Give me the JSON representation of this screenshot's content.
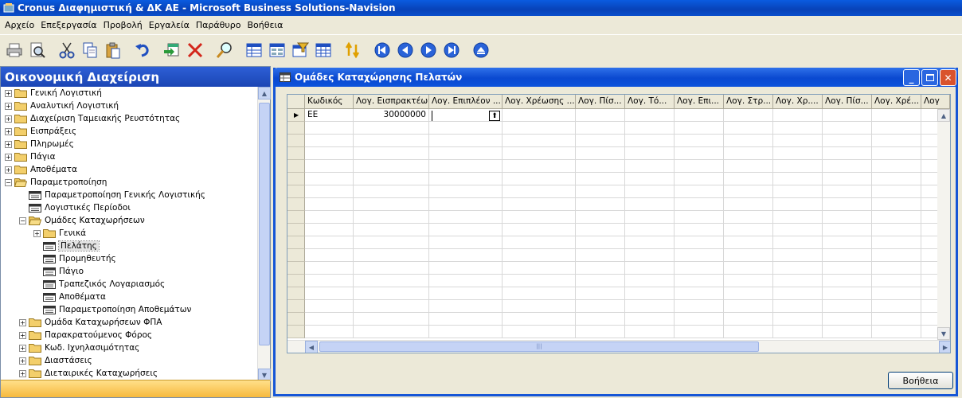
{
  "app": {
    "title": "Cronus Διαφημιστική & ΔΚ ΑΕ - Microsoft Business Solutions-Navision"
  },
  "menu": [
    "Αρχείο",
    "Επεξεργασία",
    "Προβολή",
    "Εργαλεία",
    "Παράθυρο",
    "Βοήθεια"
  ],
  "toolbar": {
    "icons": [
      "print-icon",
      "print-preview-icon",
      "cut-icon",
      "copy-icon",
      "paste-icon",
      "undo-icon",
      "insert-icon",
      "delete-icon",
      "find-icon",
      "list-icon",
      "card-icon",
      "filter-icon",
      "table-icon",
      "sort-icon",
      "first-record-icon",
      "previous-record-icon",
      "next-record-icon",
      "last-record-icon",
      "menu-icon"
    ]
  },
  "navpane": {
    "title": "Οικονομική Διαχείριση",
    "items": [
      {
        "label": "Γενική Λογιστική",
        "level": 0,
        "kind": "folder",
        "expander": "+"
      },
      {
        "label": "Αναλυτική Λογιστική",
        "level": 0,
        "kind": "folder",
        "expander": "+"
      },
      {
        "label": "Διαχείριση Ταμειακής Ρευστότητας",
        "level": 0,
        "kind": "folder",
        "expander": "+"
      },
      {
        "label": "Εισπράξεις",
        "level": 0,
        "kind": "folder",
        "expander": "+"
      },
      {
        "label": "Πληρωμές",
        "level": 0,
        "kind": "folder",
        "expander": "+"
      },
      {
        "label": "Πάγια",
        "level": 0,
        "kind": "folder",
        "expander": "+"
      },
      {
        "label": "Αποθέματα",
        "level": 0,
        "kind": "folder",
        "expander": "+"
      },
      {
        "label": "Παραμετροποίηση",
        "level": 0,
        "kind": "open-folder",
        "expander": "−"
      },
      {
        "label": "Παραμετροποίηση Γενικής Λογιστικής",
        "level": 1,
        "kind": "form",
        "expander": ""
      },
      {
        "label": "Λογιστικές Περίοδοι",
        "level": 1,
        "kind": "form",
        "expander": ""
      },
      {
        "label": "Ομάδες Καταχωρήσεων",
        "level": 1,
        "kind": "open-folder",
        "expander": "−"
      },
      {
        "label": "Γενικά",
        "level": 2,
        "kind": "folder",
        "expander": "+"
      },
      {
        "label": "Πελάτης",
        "level": 2,
        "kind": "form",
        "expander": "",
        "selected": true
      },
      {
        "label": "Προμηθευτής",
        "level": 2,
        "kind": "form",
        "expander": ""
      },
      {
        "label": "Πάγιο",
        "level": 2,
        "kind": "form",
        "expander": ""
      },
      {
        "label": "Τραπεζικός Λογαριασμός",
        "level": 2,
        "kind": "form",
        "expander": ""
      },
      {
        "label": "Αποθέματα",
        "level": 2,
        "kind": "form",
        "expander": ""
      },
      {
        "label": "Παραμετροποίηση Αποθεμάτων",
        "level": 2,
        "kind": "form",
        "expander": ""
      },
      {
        "label": "Ομάδα Καταχωρήσεων ΦΠΑ",
        "level": 1,
        "kind": "folder",
        "expander": "+"
      },
      {
        "label": "Παρακρατούμενος Φόρος",
        "level": 1,
        "kind": "folder",
        "expander": "+"
      },
      {
        "label": "Κωδ. Ιχνηλασιμότητας",
        "level": 1,
        "kind": "folder",
        "expander": "+"
      },
      {
        "label": "Διαστάσεις",
        "level": 1,
        "kind": "folder",
        "expander": "+"
      },
      {
        "label": "Διεταιρικές Καταχωρήσεις",
        "level": 1,
        "kind": "folder",
        "expander": "+"
      }
    ]
  },
  "window": {
    "title": "Ομάδες Καταχώρησης Πελατών",
    "columns": [
      "Κωδικός",
      "Λογ. Εισπρακτέων",
      "Λογ. Επιπλέον ...",
      "Λογ. Χρέωσης ...",
      "Λογ. Πίσ...",
      "Λογ. Τό...",
      "Λογ. Επι...",
      "Λογ. Στρ...",
      "Λογ. Χρ....",
      "Λογ. Πίσ...",
      "Λογ. Χρέ...",
      "Λογ"
    ],
    "rows": [
      [
        "ΕΕ",
        "30000000",
        "",
        "",
        "",
        "",
        "",
        "",
        "",
        "",
        "",
        ""
      ]
    ],
    "help_button": "Βοήθεια"
  },
  "colors": {
    "title_blue": "#0842b8",
    "nav_header": "#1b45b4",
    "window_border": "#1656d6"
  }
}
